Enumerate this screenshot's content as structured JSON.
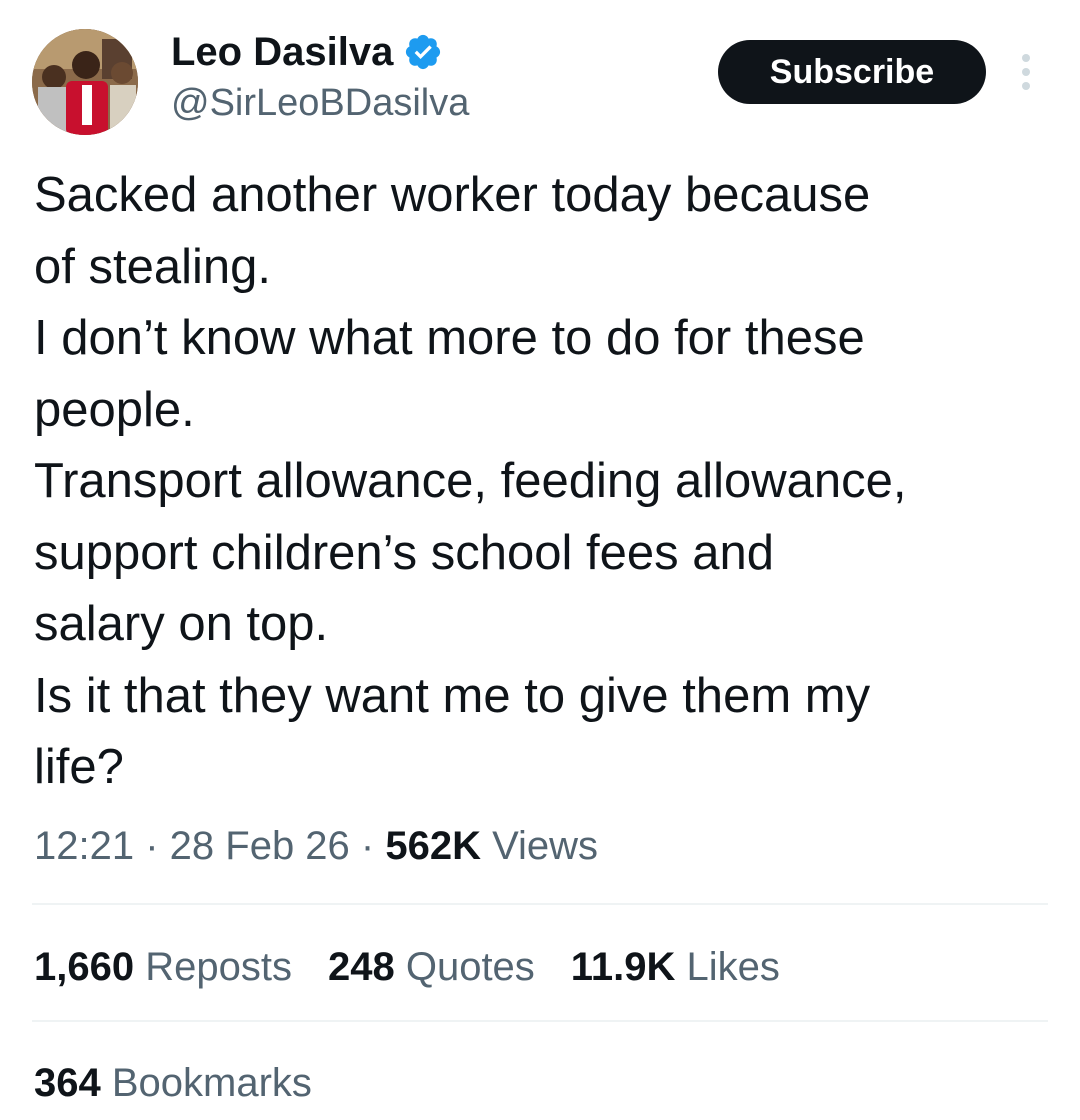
{
  "author": {
    "display_name": "Leo Dasilva",
    "handle": "@SirLeoBDasilva",
    "verified": true,
    "verified_color": "#1d9bf0",
    "avatar_icon": "profile-photo"
  },
  "actions": {
    "subscribe_label": "Subscribe",
    "more_icon": "more-vertical-icon"
  },
  "tweet": {
    "lines": [
      "Sacked another worker today because",
      "of stealing.",
      "I don’t know what more to do for these",
      "people.",
      "Transport allowance, feeding allowance,",
      "support children’s school fees and",
      "salary on top.",
      "Is it that they want me to give them my",
      "life?"
    ]
  },
  "meta": {
    "time": "12:21",
    "separator": " · ",
    "date": "28 Feb 26",
    "views_count": "562K",
    "views_label": " Views"
  },
  "stats": {
    "reposts_count": "1,660",
    "reposts_label": " Reposts",
    "quotes_count": "248",
    "quotes_label": " Quotes",
    "likes_count": "11.9K",
    "likes_label": " Likes",
    "bookmarks_count": "364",
    "bookmarks_label": " Bookmarks"
  },
  "colors": {
    "text_primary": "#0f1419",
    "text_secondary": "#536471",
    "divider": "#eff3f4",
    "button_bg": "#0f1419"
  }
}
